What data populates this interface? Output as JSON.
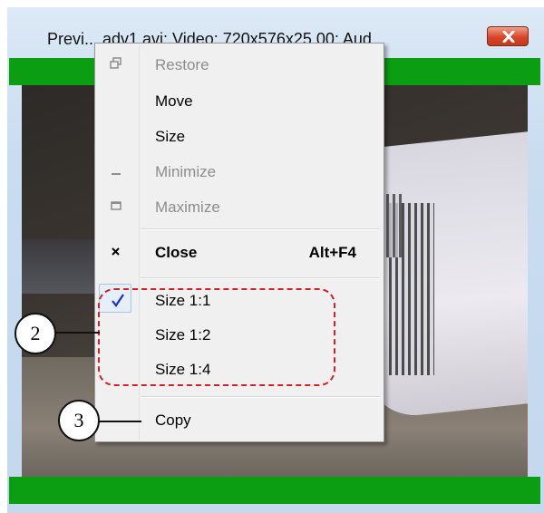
{
  "window": {
    "title": "Previ... adv1.avi; Video: 720x576x25.00; Aud...",
    "close_label": "X"
  },
  "menu": {
    "items": [
      {
        "label": "Restore",
        "icon": "restore-icon",
        "enabled": false
      },
      {
        "label": "Move",
        "enabled": true
      },
      {
        "label": "Size",
        "enabled": true
      },
      {
        "label": "Minimize",
        "icon": "minimize-icon",
        "enabled": false
      },
      {
        "label": "Maximize",
        "icon": "maximize-icon",
        "enabled": false
      },
      {
        "label": "Close",
        "icon": "close-x-icon",
        "accel": "Alt+F4",
        "bold": true,
        "enabled": true
      },
      {
        "label": "Size 1:1",
        "icon": "checkmark-icon",
        "checked": true,
        "enabled": true
      },
      {
        "label": "Size 1:2",
        "enabled": true
      },
      {
        "label": "Size 1:4",
        "enabled": true
      },
      {
        "label": "Copy",
        "enabled": true
      }
    ]
  },
  "callouts": {
    "size_group": "2",
    "copy": "3"
  },
  "colors": {
    "status_bar_green": "#0b9e12",
    "annotation_red": "#d21f26",
    "check_blue": "#1b2fd1"
  }
}
